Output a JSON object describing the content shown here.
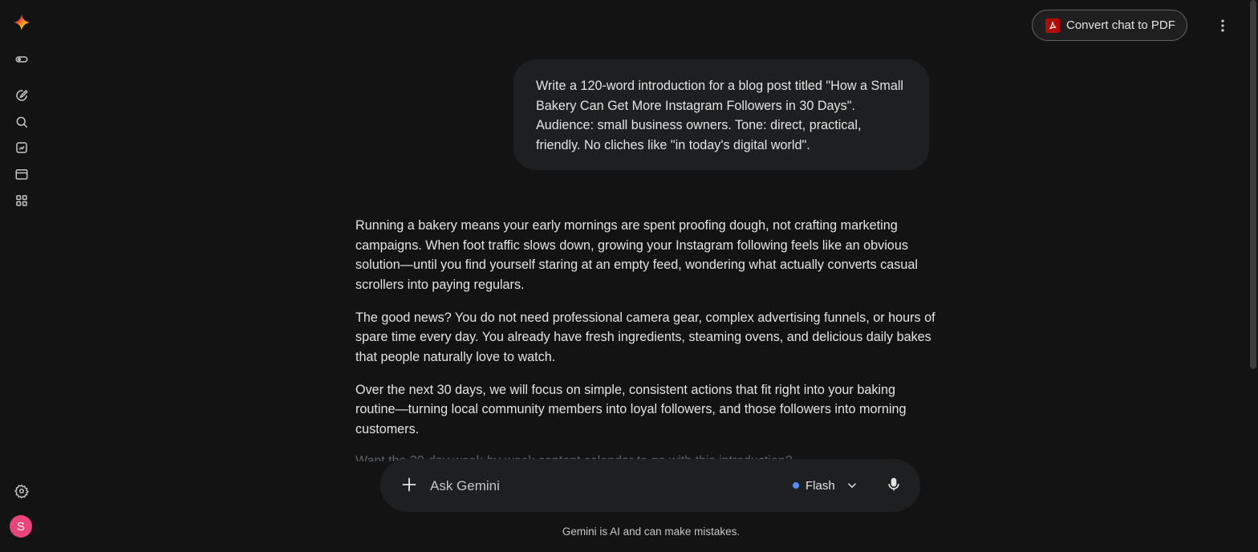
{
  "header": {
    "convert_pdf_label": "Convert chat to PDF"
  },
  "sidebar": {
    "icons": [
      "gemini-logo-icon",
      "toggle-icon",
      "edit-icon",
      "search-icon",
      "gallery-icon",
      "folder-icon",
      "apps-grid-icon",
      "settings-icon"
    ],
    "avatar_initial": "S"
  },
  "chat": {
    "user_prompt": "Write a 120-word introduction for a blog post titled \"How a Small Bakery Can Get More Instagram Followers in 30 Days\". Audience: small business owners. Tone: direct, practical, friendly. No cliches like \"in today's digital world\".",
    "response_paragraphs": [
      "Running a bakery means your early mornings are spent proofing dough, not crafting marketing campaigns. When foot traffic slows down, growing your Instagram following feels like an obvious solution—until you find yourself staring at an empty feed, wondering what actually converts casual scrollers into paying regulars.",
      "The good news? You do not need professional camera gear, complex advertising funnels, or hours of spare time every day. You already have fresh ingredients, steaming ovens, and delicious daily bakes that people naturally love to watch.",
      "Over the next 30 days, we will focus on simple, consistent actions that fit right into your baking routine—turning local community members into loyal followers, and those followers into morning customers."
    ],
    "partial_line": "Want the 30-day week-by-week content calendar to go with this introduction?"
  },
  "input": {
    "placeholder": "Ask Gemini",
    "model_label": "Flash"
  },
  "footer": {
    "disclaimer": "Gemini is AI and can make mistakes."
  },
  "colors": {
    "background": "#131314",
    "surface": "#1e1f20",
    "text": "#e3e3e3",
    "avatar": "#e8457a",
    "model_dot": "#4f8ef7",
    "pdf_red": "#b30b00"
  }
}
